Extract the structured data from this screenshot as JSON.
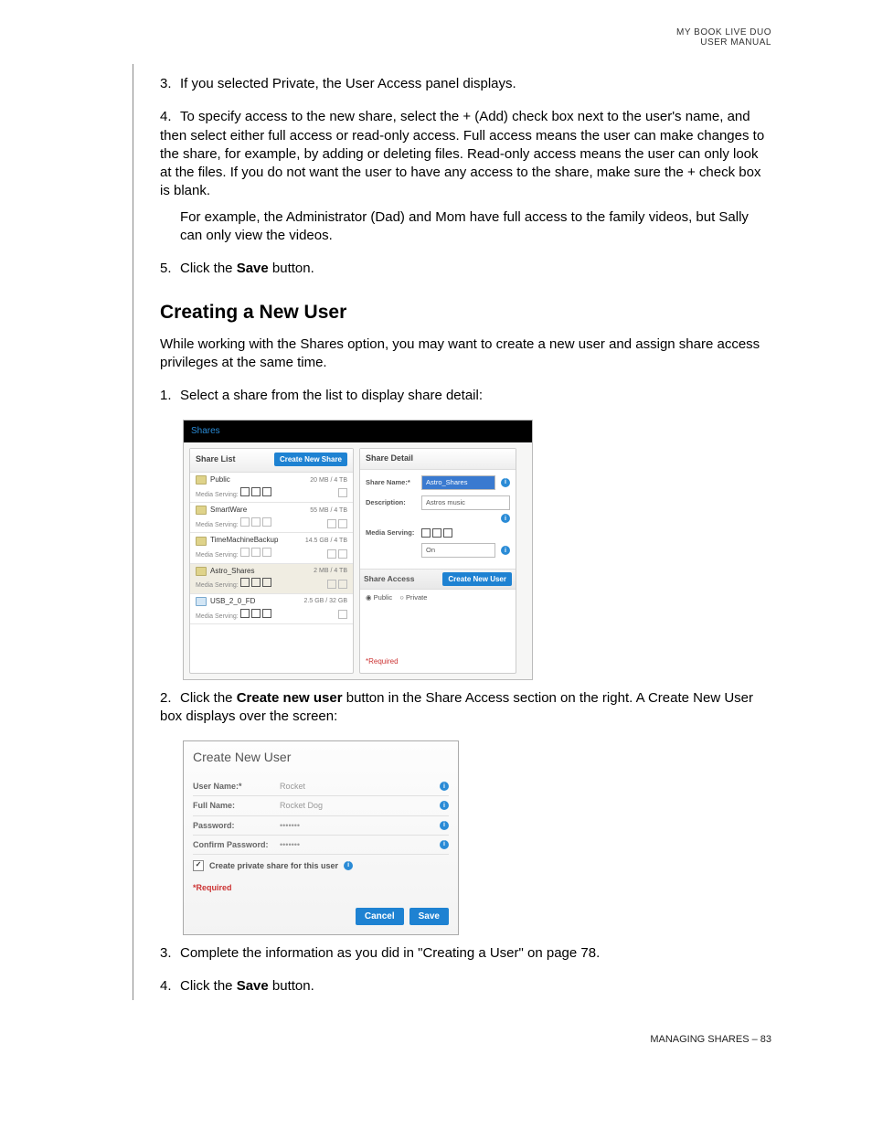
{
  "header": {
    "line1": "MY BOOK LIVE DUO",
    "line2": "USER MANUAL"
  },
  "steps_top": [
    {
      "num": "3.",
      "text": "If you selected Private, the User Access panel displays."
    },
    {
      "num": "4.",
      "text": "To specify access to the new share, select the + (Add) check box next to the user's name, and then select either full access or read-only access. Full access means the user can make changes to the share, for example, by adding or deleting files. Read-only access means the user can only look at the files. If you do not want the user to have any access to the share, make sure the + check box is blank.",
      "extra": "For example, the Administrator (Dad) and Mom have full access to the family videos, but Sally can only view the videos."
    },
    {
      "num": "5.",
      "pre": "Click the ",
      "bold": "Save",
      "post": " button."
    }
  ],
  "section_heading": "Creating a New User",
  "intro": "While working with the Shares option, you may want to create a new user and assign share access privileges at the same time.",
  "steps_mid": {
    "s1": {
      "num": "1.",
      "text": "Select a share from the list to display share detail:"
    },
    "s2": {
      "num": "2.",
      "pre": "Click the ",
      "bold": "Create new user",
      "post": " button in the Share Access section on the right. A Create New User box displays over the screen:"
    },
    "s3": {
      "num": "3.",
      "text": "Complete the information as you did in \"Creating a User\" on page 78."
    },
    "s4": {
      "num": "4.",
      "pre": "Click the ",
      "bold": "Save",
      "post": " button."
    }
  },
  "shares_panel": {
    "tab": "Shares",
    "left": {
      "title": "Share List",
      "button": "Create New Share",
      "rows": [
        {
          "name": "Public",
          "size": "20 MB / 4 TB",
          "serving": "Media Serving:"
        },
        {
          "name": "SmartWare",
          "size": "55 MB / 4 TB",
          "serving": "Media Serving:"
        },
        {
          "name": "TimeMachineBackup",
          "size": "14.5 GB / 4 TB",
          "serving": "Media Serving:"
        },
        {
          "name": "Astro_Shares",
          "size": "2 MB / 4 TB",
          "serving": "Media Serving:",
          "highlight": true
        },
        {
          "name": "USB_2_0_FD",
          "size": "2.5 GB / 32 GB",
          "serving": "Media Serving:",
          "usb": true
        }
      ]
    },
    "right": {
      "title": "Share Detail",
      "share_name_label": "Share Name:*",
      "share_name_value": "Astro_Shares",
      "description_label": "Description:",
      "description_value": "Astros music",
      "media_serving_label": "Media Serving:",
      "media_serving_value": "On",
      "share_access_title": "Share Access",
      "create_user_btn": "Create New User",
      "public_label": "Public",
      "private_label": "Private",
      "required": "*Required"
    }
  },
  "cnu": {
    "title": "Create New User",
    "rows": {
      "username_label": "User Name:*",
      "username_value": "Rocket",
      "fullname_label": "Full Name:",
      "fullname_value": "Rocket Dog",
      "password_label": "Password:",
      "password_value": "•••••••",
      "confirm_label": "Confirm Password:",
      "confirm_value": "•••••••",
      "checkbox_label": "Create private share for this user"
    },
    "required": "*Required",
    "cancel": "Cancel",
    "save": "Save"
  },
  "footer": "MANAGING SHARES – 83"
}
